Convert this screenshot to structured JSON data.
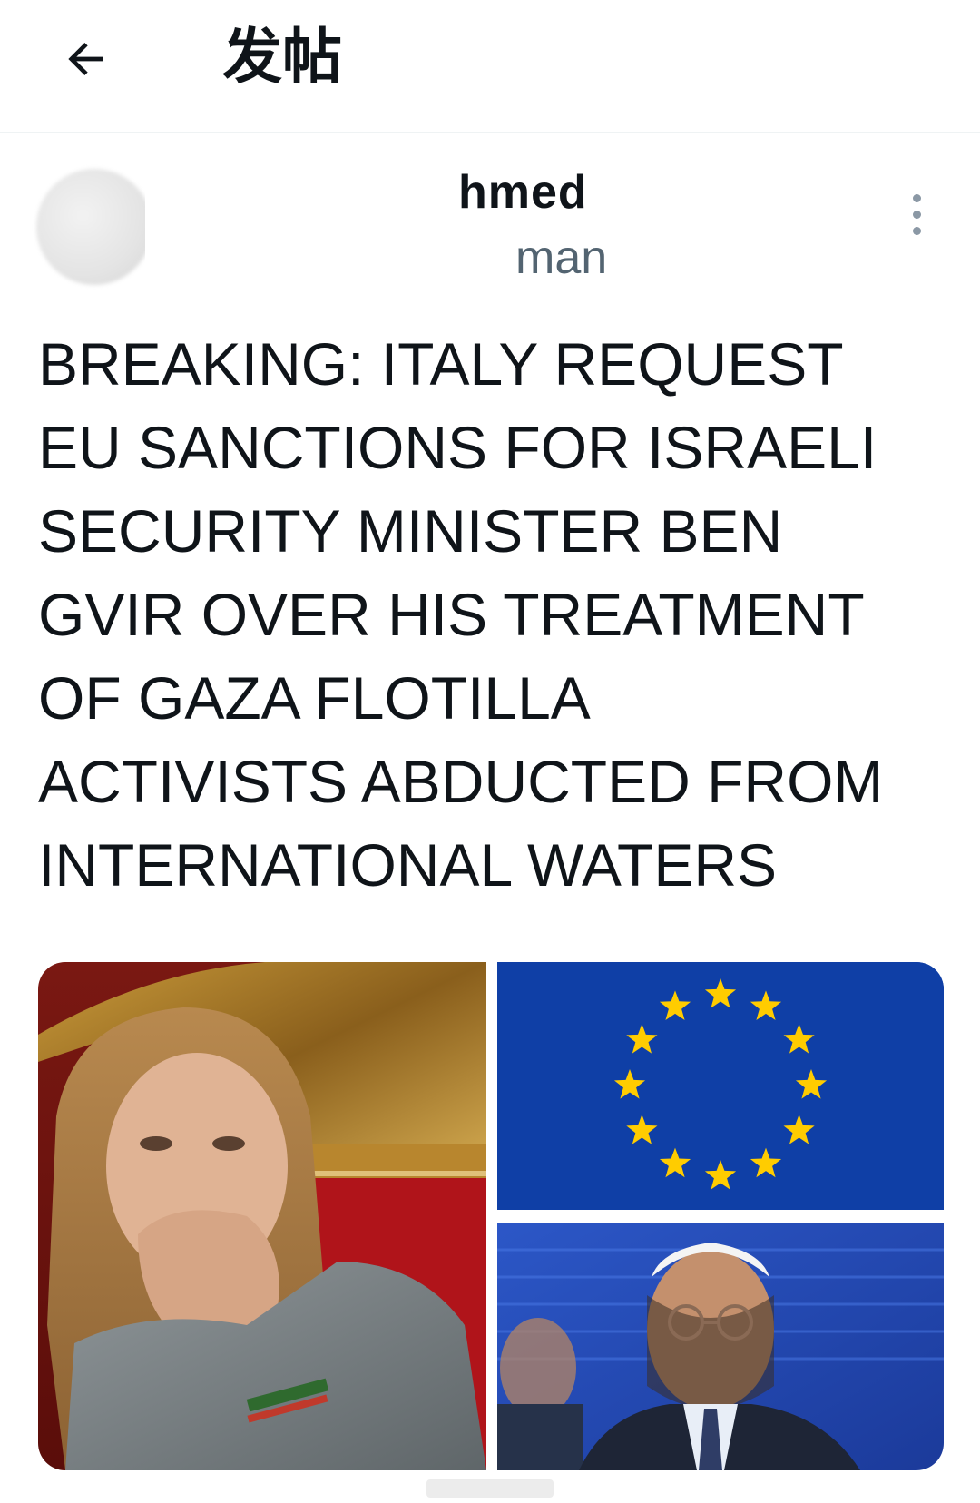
{
  "header": {
    "back_icon": "arrow-left-icon",
    "title": "发帖"
  },
  "author": {
    "name": "hmed",
    "handle": "man",
    "more_icon": "more-vertical-icon"
  },
  "post": {
    "text": "BREAKING: ITALY REQUEST\nEU SANCTIONS FOR ISRAELI\nSECURITY MINISTER BEN\nGVIR OVER HIS TREATMENT\nOF GAZA FLOTILLA\nACTIVISTS ABDUCTED FROM\nINTERNATIONAL WATERS"
  },
  "media": {
    "images": [
      {
        "description_name": "woman-at-parliament-photo"
      },
      {
        "description_name": "eu-flag-photo"
      },
      {
        "description_name": "man-with-kippah-photo"
      }
    ]
  },
  "colors": {
    "text_primary": "#0f1419",
    "text_secondary": "#536471",
    "divider": "#eff3f4",
    "eu_blue": "#0f3fa6",
    "eu_gold": "#ffcc00"
  }
}
